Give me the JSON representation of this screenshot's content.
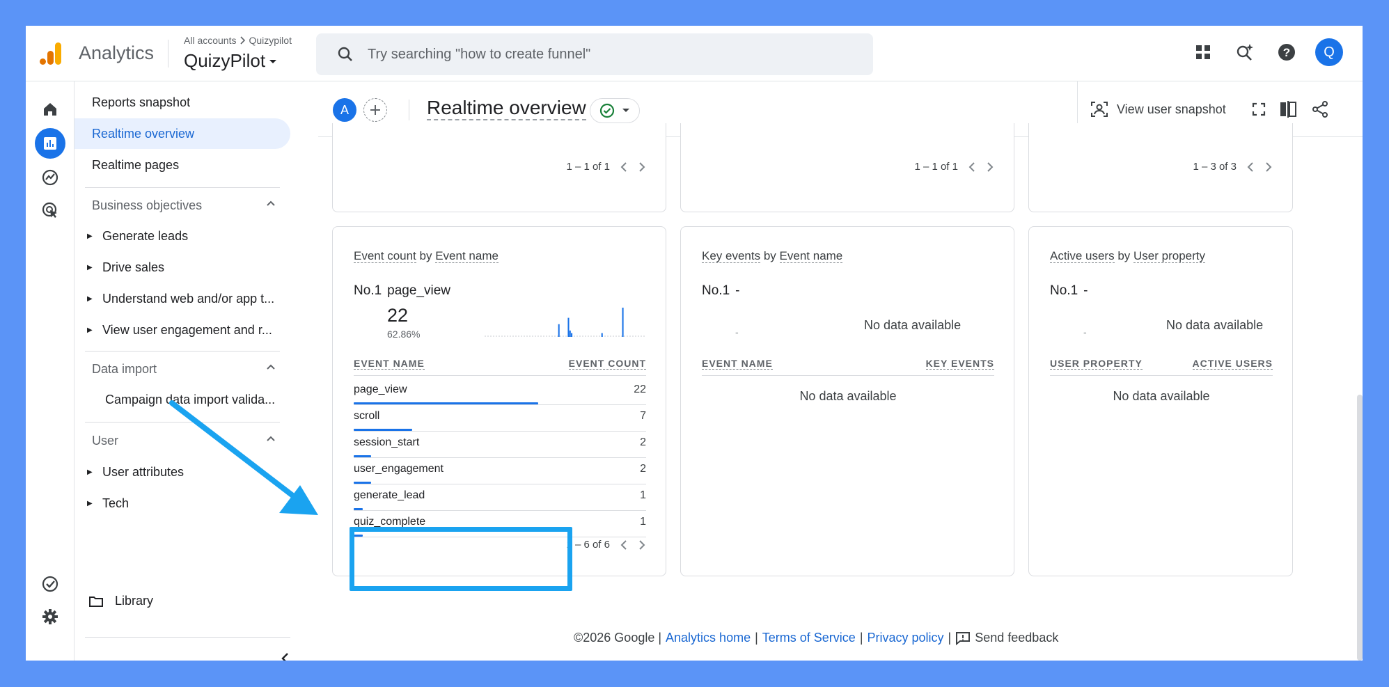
{
  "app": {
    "product_name": "Analytics",
    "account_crumb_root": "All accounts",
    "account_crumb_child": "Quizypilot",
    "property_name": "QuizyPilot",
    "search_placeholder": "Try searching \"how to create funnel\"",
    "user_initial": "Q"
  },
  "sidebar": {
    "items": [
      {
        "label": "Reports snapshot"
      },
      {
        "label": "Realtime overview"
      },
      {
        "label": "Realtime pages"
      }
    ],
    "sections": [
      {
        "title": "Business objectives",
        "items": [
          "Generate leads",
          "Drive sales",
          "Understand web and/or app t...",
          "View user engagement and r..."
        ]
      },
      {
        "title": "Data import",
        "items": [
          "Campaign data import valida..."
        ]
      },
      {
        "title": "User",
        "items": [
          "User attributes",
          "Tech"
        ]
      }
    ],
    "library_label": "Library"
  },
  "header": {
    "comparison_label": "A",
    "title": "Realtime overview",
    "view_snapshot": "View user snapshot"
  },
  "top_cards": [
    {
      "pager": "1 – 1 of 1"
    },
    {
      "pager": "1 – 1 of 1"
    },
    {
      "pager": "1 – 3 of 3"
    }
  ],
  "cards": {
    "events": {
      "title_metric": "Event count",
      "title_by": "by",
      "title_dim": "Event name",
      "rank": "No.1",
      "top_name": "page_view",
      "top_value": "22",
      "top_pct": "62.86%",
      "col_name": "EVENT NAME",
      "col_value": "EVENT COUNT",
      "rows": [
        {
          "name": "page_view",
          "value": "22",
          "share": 0.63
        },
        {
          "name": "scroll",
          "value": "7",
          "share": 0.2
        },
        {
          "name": "session_start",
          "value": "2",
          "share": 0.06
        },
        {
          "name": "user_engagement",
          "value": "2",
          "share": 0.06
        },
        {
          "name": "generate_lead",
          "value": "1",
          "share": 0.03
        },
        {
          "name": "quiz_complete",
          "value": "1",
          "share": 0.03
        }
      ],
      "pager": "1 – 6 of 6",
      "sparkline": [
        0,
        0,
        0,
        0,
        0,
        0,
        0,
        0,
        0,
        0,
        0,
        0,
        0,
        0,
        0,
        0,
        0,
        0,
        0,
        0,
        0,
        0,
        0,
        0,
        0,
        0,
        0,
        0,
        0,
        0,
        0,
        0,
        0,
        0,
        0,
        0,
        0,
        0,
        0,
        0,
        0,
        0,
        0,
        0,
        0,
        0,
        1,
        0,
        0,
        0,
        0,
        0,
        1.5,
        0.5,
        0.3,
        0,
        0,
        0,
        0,
        0,
        0,
        0,
        0,
        0,
        0,
        0,
        0,
        0,
        0,
        0,
        0,
        0,
        0,
        0.3,
        0,
        0,
        0,
        0,
        0,
        0,
        0,
        0,
        0,
        0,
        0,
        0,
        2.3,
        0,
        0,
        0,
        0,
        0,
        0,
        0,
        0,
        0,
        0,
        0,
        0,
        0,
        0
      ]
    },
    "key_events": {
      "title_metric": "Key events",
      "title_by": "by",
      "title_dim": "Event name",
      "rank": "No.1",
      "top_name": "-",
      "dash": "-",
      "chart_nodata": "No data available",
      "col_name": "EVENT NAME",
      "col_value": "KEY EVENTS",
      "table_nodata": "No data available"
    },
    "users": {
      "title_metric": "Active users",
      "title_by": "by",
      "title_dim": "User property",
      "rank": "No.1",
      "top_name": "-",
      "dash": "-",
      "chart_nodata": "No data available",
      "col_name": "USER PROPERTY",
      "col_value": "ACTIVE USERS",
      "table_nodata": "No data available"
    }
  },
  "footer": {
    "copyright": "©2026 Google |",
    "analytics_home": "Analytics home",
    "sep1": "|",
    "terms": "Terms of Service",
    "sep2": "|",
    "privacy": "Privacy policy",
    "sep3": "|",
    "feedback": "Send feedback"
  },
  "colors": {
    "brand": "#1a73e8",
    "annotation": "#1aa3f0",
    "background": "#5b94f7"
  }
}
